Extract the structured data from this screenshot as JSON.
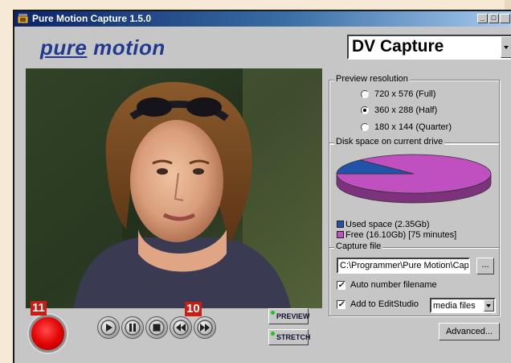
{
  "window": {
    "title": "Pure Motion Capture 1.5.0",
    "min_label": "_",
    "max_label": "□"
  },
  "brand": {
    "word1": "pure",
    "word2": "motion"
  },
  "mode_select": {
    "value": "DV Capture"
  },
  "markers": {
    "record": "11",
    "transport": "10"
  },
  "side_buttons": {
    "preview": "PREVIEW",
    "stretch": "STRETCH"
  },
  "preview_resolution": {
    "label": "Preview resolution",
    "options": [
      "720 x 576 (Full)",
      "360 x 288 (Half)",
      "180 x 144 (Quarter)"
    ],
    "selected_index": 1
  },
  "disk_space": {
    "label": "Disk space on current drive",
    "used_label": "Used space (2.35Gb)",
    "free_label": "Free (16.10Gb) [75 minutes]",
    "used_gb": 2.35,
    "free_gb": 16.1,
    "used_color": "#2353a8",
    "free_color": "#c04fbf"
  },
  "capture_file": {
    "label": "Capture file",
    "path": "C:\\Programmer\\Pure Motion\\Cap",
    "browse_label": "...",
    "auto_number_label": "Auto number filename",
    "auto_number_checked": true,
    "add_label": "Add to EditStudio",
    "add_checked": true,
    "target_value": "media files"
  },
  "advanced_label": "Advanced..."
}
